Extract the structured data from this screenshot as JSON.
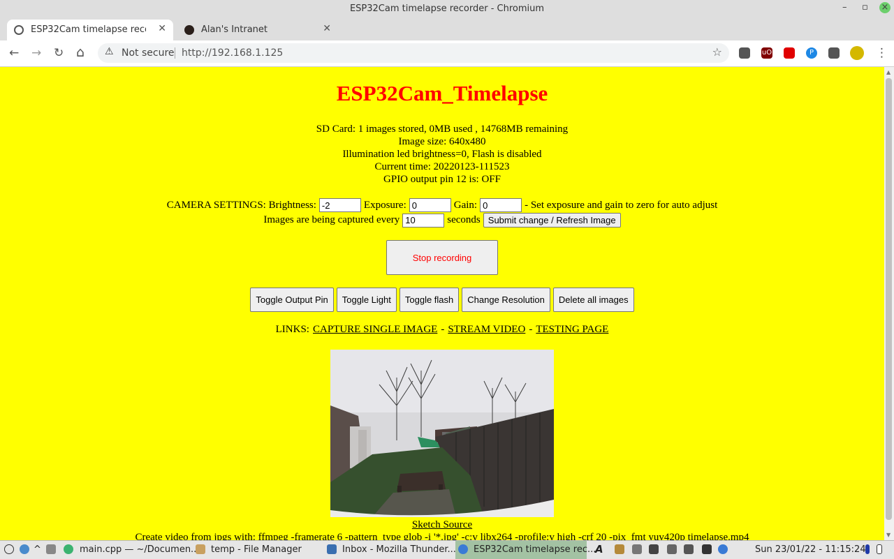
{
  "window": {
    "title": "ESP32Cam timelapse recorder - Chromium",
    "minimize": "–",
    "maximize": "▫",
    "close": "×"
  },
  "tabs": [
    {
      "label": "ESP32Cam timelapse recorder",
      "close": "✕"
    },
    {
      "label": "Alan's Intranet",
      "close": "✕"
    }
  ],
  "new_tab": "+",
  "toolbar": {
    "back": "←",
    "forward": "→",
    "reload": "↻",
    "home": "⌂"
  },
  "omnibox": {
    "warning_icon": "⚠",
    "security_text": "Not secure",
    "url": "http://192.168.1.125",
    "star": "☆"
  },
  "page": {
    "heading": "ESP32Cam_Timelapse",
    "info_lines": [
      "SD Card: 1 images stored, 0MB used , 14768MB remaining",
      "Image size: 640x480",
      "Illumination led brightness=0, Flash is disabled",
      "Current time: 20220123-111523",
      "GPIO output pin 12 is: OFF"
    ],
    "camera": {
      "prefix": "CAMERA SETTINGS: Brightness:",
      "brightness": "-2",
      "exposure_label": "Exposure:",
      "exposure": "0",
      "gain_label": "Gain:",
      "gain": "0",
      "note": "- Set exposure and gain to zero for auto adjust",
      "interval_prefix": "Images are being captured every",
      "interval": "10",
      "interval_suffix": "seconds",
      "submit_label": "Submit change / Refresh Image"
    },
    "stop_label": "Stop recording",
    "buttons": [
      "Toggle Output Pin",
      "Toggle Light",
      "Toggle flash",
      "Change Resolution",
      "Delete all images"
    ],
    "links": {
      "prefix": "LINKS:",
      "capture": "CAPTURE SINGLE IMAGE",
      "sep1": "-",
      "stream": "STREAM VIDEO",
      "sep2": "-",
      "testing": "TESTING PAGE"
    },
    "sketch_link": "Sketch Source",
    "ffmpeg_line": "Create video from jpgs with: ffmpeg -framerate 6 -pattern_type glob -i '*.jpg' -c:v libx264 -profile:v high -crf 20 -pix_fmt yuv420p timelapse.mp4"
  },
  "taskbar": {
    "items": [
      "main.cpp — ~/Documen...",
      "temp - File Manager",
      "Inbox - Mozilla Thunder...",
      "ESP32Cam timelapse rec..."
    ],
    "clock": "Sun 23/01/22 - 11:15:24"
  }
}
